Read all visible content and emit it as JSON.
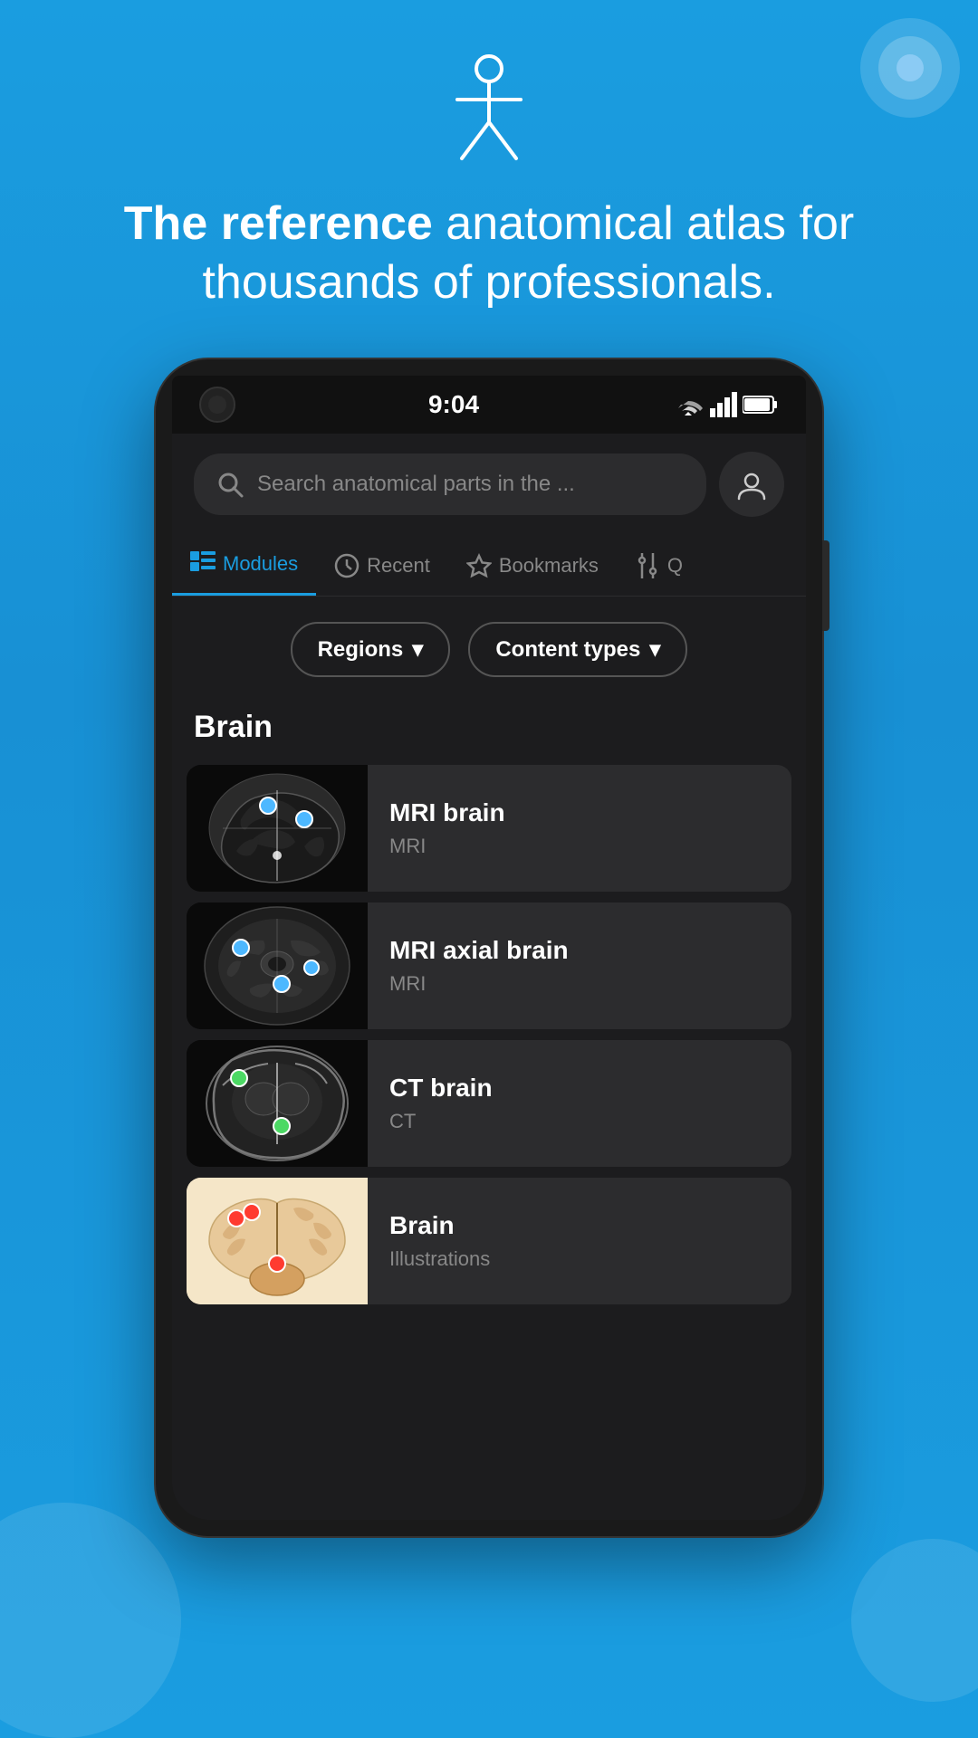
{
  "app": {
    "background_color": "#1a9de0"
  },
  "hero": {
    "title_bold": "The reference",
    "title_normal": " anatomical atlas for thousands of professionals."
  },
  "phone": {
    "time": "9:04",
    "status_icons": [
      "wifi",
      "signal",
      "battery"
    ]
  },
  "search": {
    "placeholder": "Search anatomical parts in the ...",
    "profile_icon": "user-icon"
  },
  "nav": {
    "tabs": [
      {
        "id": "modules",
        "label": "Modules",
        "active": true,
        "icon": "modules-icon"
      },
      {
        "id": "recent",
        "label": "Recent",
        "active": false,
        "icon": "clock-icon"
      },
      {
        "id": "bookmarks",
        "label": "Bookmarks",
        "active": false,
        "icon": "star-icon"
      },
      {
        "id": "search2",
        "label": "Q",
        "active": false,
        "icon": "filter-icon"
      }
    ]
  },
  "filters": {
    "regions_label": "Regions",
    "content_types_label": "Content types",
    "chevron": "▾"
  },
  "section": {
    "title": "Brain"
  },
  "modules": [
    {
      "id": "mri-brain",
      "name": "MRI brain",
      "type": "MRI",
      "thumbnail_type": "mri_sagittal"
    },
    {
      "id": "mri-axial-brain",
      "name": "MRI axial brain",
      "type": "MRI",
      "thumbnail_type": "mri_axial"
    },
    {
      "id": "ct-brain",
      "name": "CT brain",
      "type": "CT",
      "thumbnail_type": "ct_axial"
    },
    {
      "id": "brain-illustrations",
      "name": "Brain",
      "type": "Illustrations",
      "thumbnail_type": "illustration"
    }
  ]
}
